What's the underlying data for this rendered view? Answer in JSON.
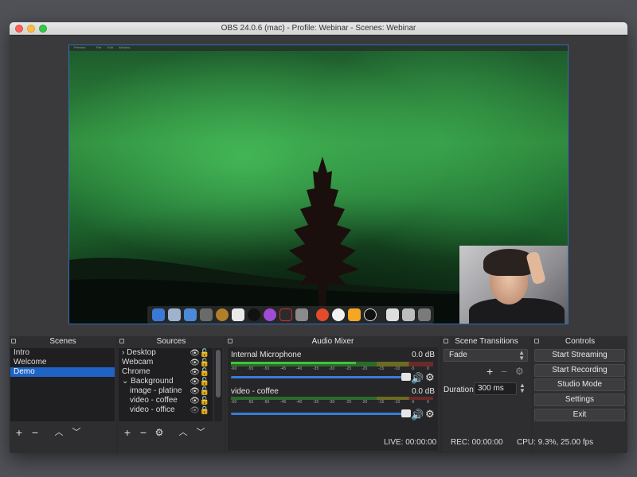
{
  "window": {
    "title": "OBS 24.0.6 (mac) - Profile: Webinar - Scenes: Webinar"
  },
  "preview": {
    "mac_menu": [
      "Preview",
      "File",
      "Edit",
      "Window"
    ]
  },
  "panels": {
    "scenes": {
      "title": "Scenes",
      "items": [
        "Intro",
        "Welcome",
        "Demo"
      ],
      "selected": "Demo"
    },
    "sources": {
      "title": "Sources",
      "items": [
        {
          "label": "Desktop",
          "prefix": "›"
        },
        {
          "label": "Webcam",
          "prefix": ""
        },
        {
          "label": "Chrome",
          "prefix": ""
        },
        {
          "label": "Background",
          "prefix": "⌄"
        },
        {
          "label": "image - platine",
          "prefix": ""
        },
        {
          "label": "video - coffee",
          "prefix": ""
        },
        {
          "label": "video - office",
          "prefix": ""
        }
      ]
    },
    "mixer": {
      "title": "Audio Mixer",
      "channels": [
        {
          "name": "Internal Microphone",
          "db": "0.0 dB",
          "level": 0.62,
          "volume": 1.0
        },
        {
          "name": "video - coffee",
          "db": "0.0 dB",
          "level": 0.0,
          "volume": 1.0
        }
      ],
      "ticks": [
        "-60",
        "-55",
        "-50",
        "-45",
        "-40",
        "-35",
        "-30",
        "-25",
        "-20",
        "-15",
        "-10",
        "-5",
        "0"
      ]
    },
    "transitions": {
      "title": "Scene Transitions",
      "selected": "Fade",
      "duration_label": "Duration",
      "duration_value": "300 ms"
    },
    "controls": {
      "title": "Controls",
      "buttons": [
        "Start Streaming",
        "Start Recording",
        "Studio Mode",
        "Settings",
        "Exit"
      ]
    }
  },
  "status": {
    "live": "LIVE: 00:00:00",
    "rec": "REC: 00:00:00",
    "cpu": "CPU: 9.3%, 25.00 fps"
  },
  "colors": {
    "accent": "#1f63c6",
    "meter_green": "#41c33a",
    "slider_blue": "#3a7cd8"
  }
}
